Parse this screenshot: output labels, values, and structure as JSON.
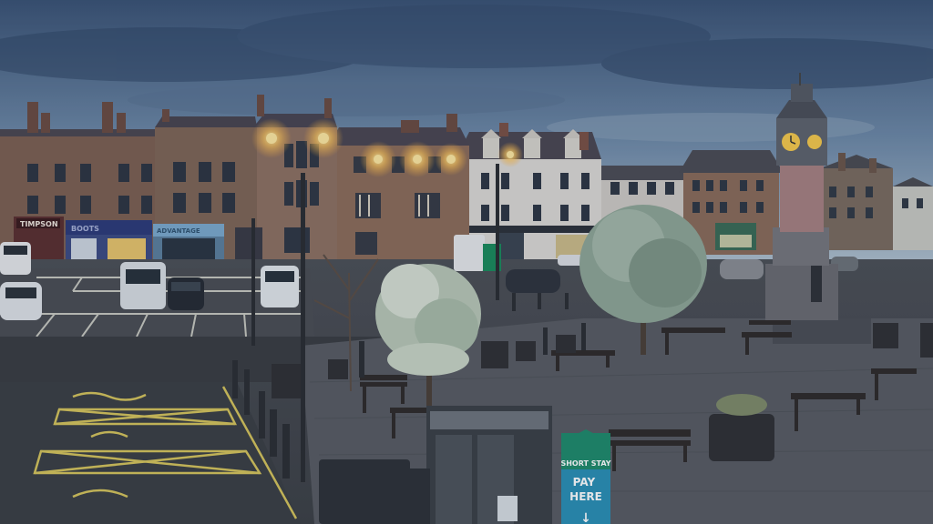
{
  "scene": {
    "shop_signs": [
      "TIMPSON",
      "BOOTS",
      "ADVANTAGE"
    ],
    "parking_sign": {
      "top": "SHORT STAY",
      "main": "PAY\nHERE",
      "arrow": "↓"
    },
    "colors": {
      "sky_top": "#3e5678",
      "sky_bottom": "#a8bccb",
      "lamp_glow": "#ffd070",
      "clock_face": "#f6c94a",
      "road": "#3a3d42",
      "paving": "#5c5f66",
      "tree_foliage": "#9fb2a0",
      "sign_green": "#1e8a6a"
    }
  }
}
